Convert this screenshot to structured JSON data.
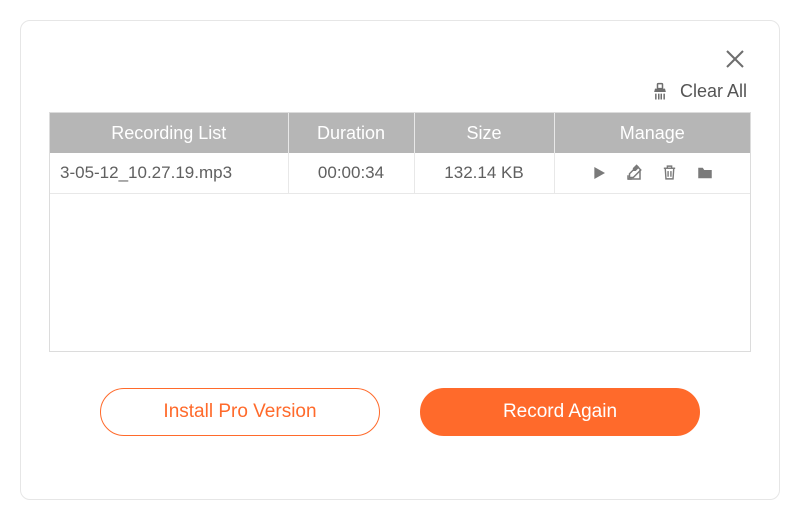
{
  "colors": {
    "accent": "#ff6a2b"
  },
  "clear_all_label": "Clear All",
  "columns": {
    "recording_list": "Recording List",
    "duration": "Duration",
    "size": "Size",
    "manage": "Manage"
  },
  "rows": [
    {
      "filename": "3-05-12_10.27.19.mp3",
      "duration": "00:00:34",
      "size": "132.14 KB"
    }
  ],
  "buttons": {
    "install_pro": "Install Pro Version",
    "record_again": "Record Again"
  }
}
